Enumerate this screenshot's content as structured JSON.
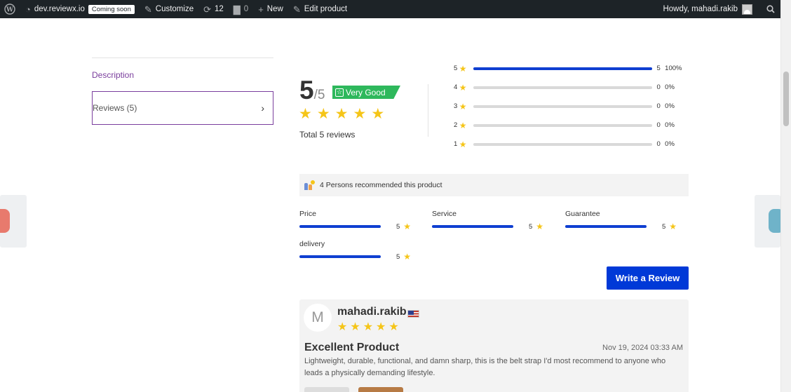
{
  "adminbar": {
    "site": "dev.reviewx.io",
    "soon_badge": "Coming soon",
    "customize": "Customize",
    "updates": "12",
    "comments": "0",
    "new": "New",
    "edit": "Edit product",
    "howdy": "Howdy, mahadi.rakib"
  },
  "tabs": {
    "description": "Description",
    "reviews": "Reviews (5)"
  },
  "summary": {
    "score": "5",
    "out_of": "/5",
    "badge": "Very Good",
    "badge_color": "#2eb85c",
    "total": "Total 5 reviews",
    "stars": 5
  },
  "distribution": [
    {
      "star": "5",
      "count": "5",
      "percent": "100%",
      "fraction": 1.0
    },
    {
      "star": "4",
      "count": "0",
      "percent": "0%",
      "fraction": 0
    },
    {
      "star": "3",
      "count": "0",
      "percent": "0%",
      "fraction": 0
    },
    {
      "star": "2",
      "count": "0",
      "percent": "0%",
      "fraction": 0
    },
    {
      "star": "1",
      "count": "0",
      "percent": "0%",
      "fraction": 0
    }
  ],
  "recommend": "4 Persons recommended this product",
  "criteria": [
    {
      "label": "Price",
      "value": "5"
    },
    {
      "label": "Service",
      "value": "5"
    },
    {
      "label": "Guarantee",
      "value": "5"
    },
    {
      "label": "delivery",
      "value": "5"
    }
  ],
  "write_review": "Write a Review",
  "review": {
    "initial": "M",
    "name": "mahadi.rakib",
    "title": "Excellent Product",
    "date": "Nov 19, 2024 03:33 AM",
    "text": "Lightweight, durable, functional, and damn sharp, this is the belt strap I'd most recommend to anyone who leads a physically demanding lifestyle."
  },
  "colors": {
    "accent": "#0039d7",
    "bar": "#0f3fd1",
    "star": "#f5c518",
    "tab_active": "#7a3e9d"
  }
}
